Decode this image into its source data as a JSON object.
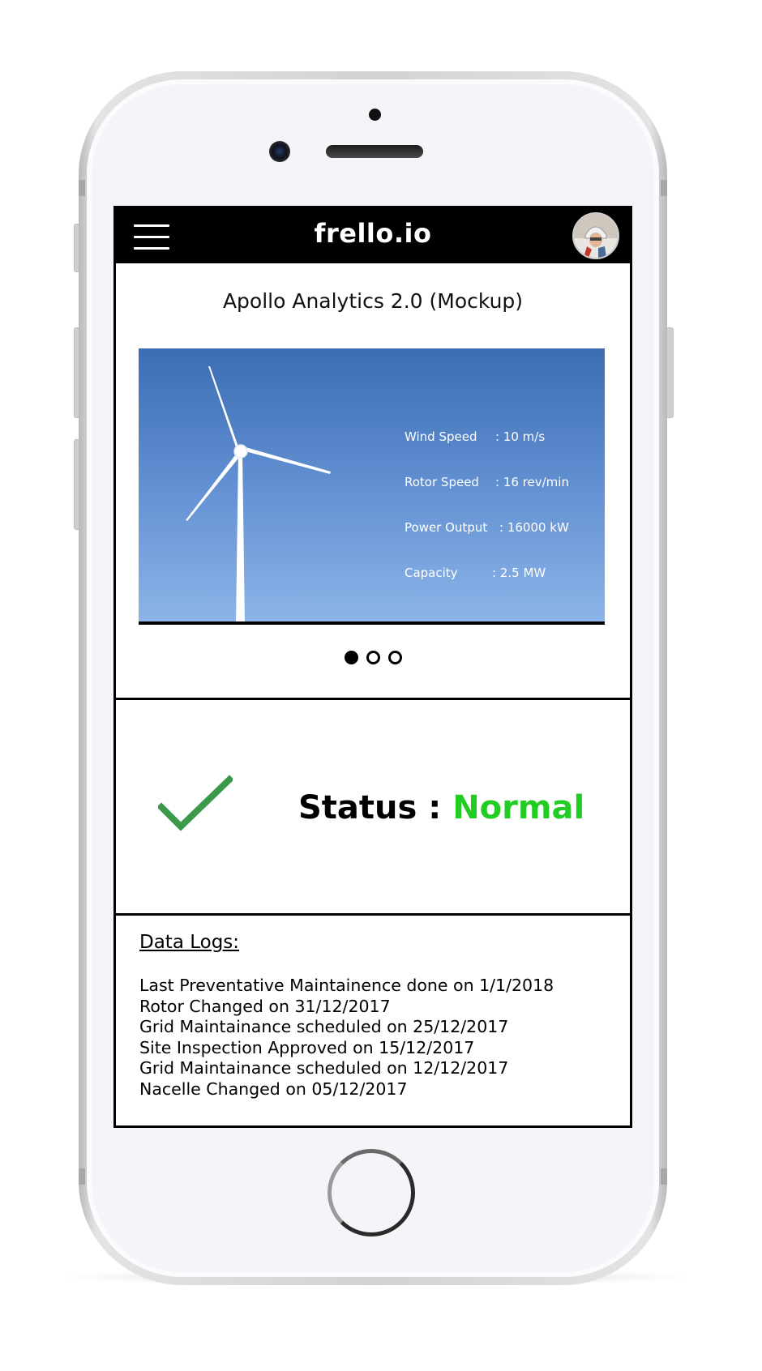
{
  "app": {
    "brand": "frello.io",
    "page_title": "Apollo Analytics 2.0 (Mockup)"
  },
  "turbine_stats": [
    {
      "label": "Wind Speed",
      "value": ": 10 m/s"
    },
    {
      "label": "Rotor Speed",
      "value": ": 16 rev/min"
    },
    {
      "label": "Power Output",
      "value": ": 16000 kW"
    },
    {
      "label": "Capacity",
      "value": ": 2.5 MW"
    }
  ],
  "carousel": {
    "pages": 3,
    "active_index": 0
  },
  "status": {
    "label": "Status :",
    "value": "Normal",
    "value_color": "#22cc22"
  },
  "data_logs": {
    "title": "Data Logs:",
    "entries": [
      "Last Preventative Maintainence done on 1/1/2018",
      "Rotor Changed on 31/12/2017",
      "Grid Maintainance scheduled on 25/12/2017",
      "Site Inspection Approved on 15/12/2017",
      "Grid Maintainance scheduled on 12/12/2017",
      "Nacelle Changed on 05/12/2017"
    ]
  },
  "icons": {
    "menu": "hamburger-menu-icon",
    "profile": "user-avatar",
    "status": "checkmark-icon"
  },
  "colors": {
    "topbar": "#000000",
    "sky_top": "#3c6db3",
    "sky_bottom": "#8cb4e8",
    "status_ok": "#22cc22",
    "check": "#3a9a4a"
  }
}
